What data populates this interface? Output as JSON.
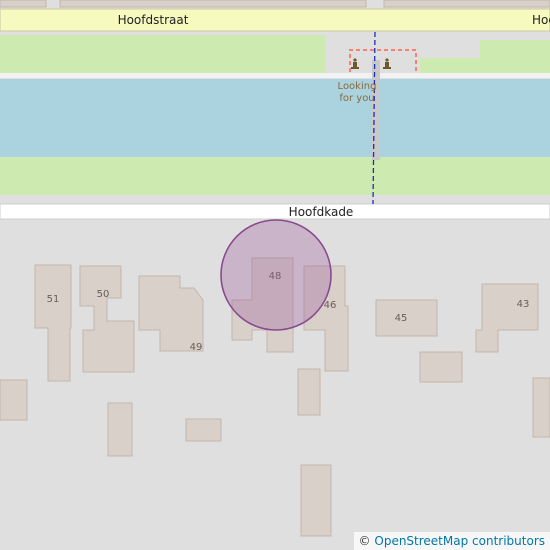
{
  "map": {
    "roads": {
      "top": "Hoofdstraat",
      "top_right_partial": "Hoo",
      "bottom": "Hoofdkade"
    },
    "poi": {
      "label_line1": "Looking",
      "label_line2": "for you"
    },
    "house_numbers": [
      "51",
      "50",
      "49",
      "48",
      "46",
      "45",
      "43"
    ],
    "highlight": {
      "house_number": "48"
    },
    "colors": {
      "water": "#aad3df",
      "grass": "#cdebb0",
      "building": "#d9d0c9",
      "background": "#e0dfdf",
      "highlight": "#9b59a0"
    }
  },
  "attribution": {
    "symbol": "©",
    "text": "OpenStreetMap contributors"
  }
}
